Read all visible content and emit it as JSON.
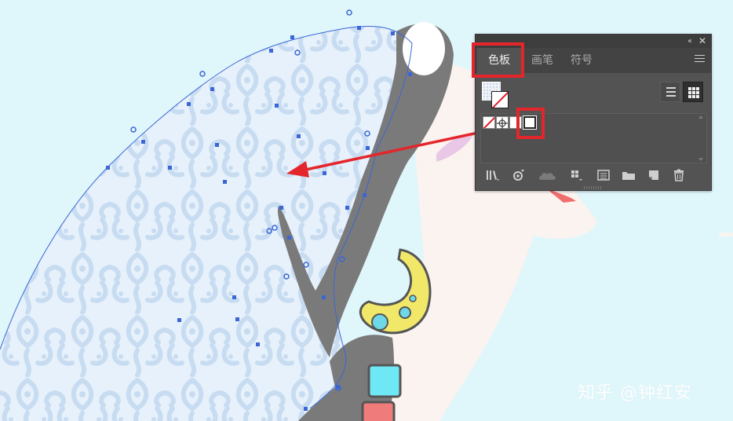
{
  "panel": {
    "tabs": [
      {
        "label": "色板",
        "active": true
      },
      {
        "label": "画笔",
        "active": false
      },
      {
        "label": "符号",
        "active": false
      }
    ],
    "collapse_glyph": "‹‹",
    "close_glyph": "✕",
    "icons": {
      "menu": "hamburger-menu-icon",
      "list_view": "list-view-icon",
      "grid_view": "grid-view-icon",
      "bottom": [
        "swatch-libraries-icon",
        "place-swatch-icon",
        "cloud-library-icon",
        "swatch-kinds-icon",
        "swatch-options-icon",
        "new-color-group-icon",
        "new-swatch-icon",
        "delete-swatch-icon"
      ]
    }
  },
  "colors": {
    "canvas_bg": "#dff6fb",
    "panel_bg": "#535353",
    "highlight": "#e3262b",
    "selection_blue": "#3a66d6",
    "pattern_fill": "#d2e2f2",
    "body_gray": "#7a7a7a",
    "face": "#fbf3ef",
    "yellow": "#f1e86a",
    "cyan": "#6fe3f0",
    "pink": "#f07b7b"
  },
  "watermark": "知乎 @钟红安"
}
